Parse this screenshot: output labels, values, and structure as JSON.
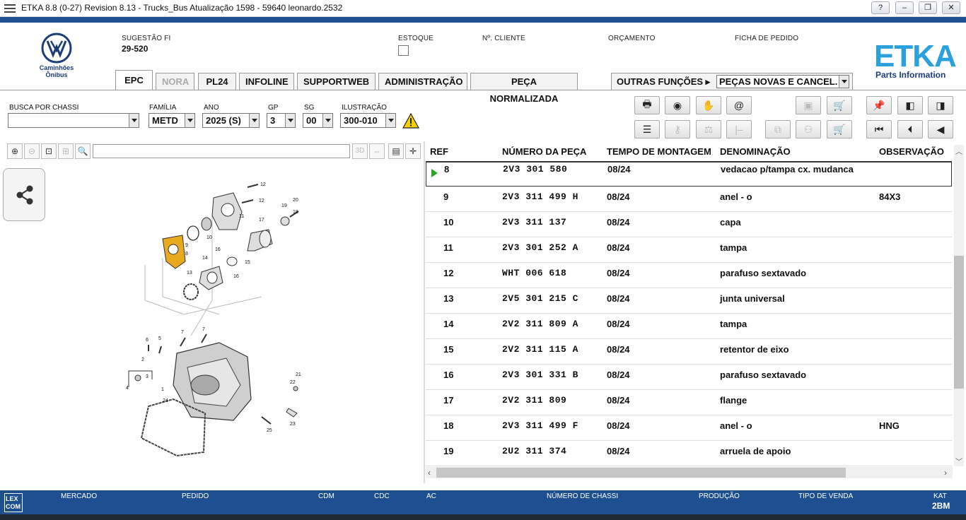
{
  "window": {
    "title": "ETKA 8.8 (0-27) Revision 8.13 - Trucks_Bus Atualização 1598 - 59640 leonardo.2532",
    "buttons": [
      "?",
      "–",
      "❐",
      "✕"
    ]
  },
  "header": {
    "brand_sub_1": "Caminhões",
    "brand_sub_2": "Ônibus",
    "sugestao_label": "SUGESTÃO FI",
    "sugestao_value": "29-520",
    "estoque_label": "ESTOQUE",
    "cliente_label": "Nº. CLIENTE",
    "orcamento_label": "ORÇAMENTO",
    "ficha_label": "FICHA DE PEDIDO",
    "etka_logo": "ETKA",
    "etka_sub": "Parts Information"
  },
  "tabs": [
    {
      "label": "EPC",
      "active": true
    },
    {
      "label": "NORA",
      "disabled": true
    },
    {
      "label": "PL24"
    },
    {
      "label": "INFOLINE"
    },
    {
      "label": "SUPPORTWEB"
    },
    {
      "label": "ADMINISTRAÇÃO"
    },
    {
      "label": "PEÇA NORMALIZADA"
    }
  ],
  "outras": {
    "label": "OUTRAS FUNÇÕES ▸",
    "selected": "PEÇAS NOVAS E CANCEL."
  },
  "filters": {
    "chassi_label": "BUSCA POR CHASSI",
    "chassi_value": "",
    "familia_label": "FAMÍLIA",
    "familia_value": "METD",
    "ano_label": "ANO",
    "ano_value": "2025 (S)",
    "gp_label": "GP",
    "gp_value": "3",
    "sg_label": "SG",
    "sg_value": "00",
    "ilustracao_label": "ILUSTRAÇÃO",
    "ilustracao_value": "300-010"
  },
  "table": {
    "headers": [
      "REF",
      "NÚMERO DA PEÇA",
      "TEMPO DE MONTAGEM",
      "DENOMINAÇÃO",
      "OBSERVAÇÃO"
    ],
    "rows": [
      {
        "ref": "8",
        "part": "2V3 301 580",
        "tempo": "08/24",
        "denom": "vedacao p/tampa cx. mudanca",
        "obs": ""
      },
      {
        "ref": "9",
        "part": "2V3 311 499 H",
        "tempo": "08/24",
        "denom": "anel - o",
        "obs": "84X3"
      },
      {
        "ref": "10",
        "part": "2V3 311 137",
        "tempo": "08/24",
        "denom": "capa",
        "obs": ""
      },
      {
        "ref": "11",
        "part": "2V3 301 252 A",
        "tempo": "08/24",
        "denom": "tampa",
        "obs": ""
      },
      {
        "ref": "12",
        "part": "WHT 006 618",
        "tempo": "08/24",
        "denom": "parafuso sextavado",
        "obs": ""
      },
      {
        "ref": "13",
        "part": "2V5 301 215 C",
        "tempo": "08/24",
        "denom": "junta universal",
        "obs": ""
      },
      {
        "ref": "14",
        "part": "2V2 311 809 A",
        "tempo": "08/24",
        "denom": "tampa",
        "obs": ""
      },
      {
        "ref": "15",
        "part": "2V2 311 115 A",
        "tempo": "08/24",
        "denom": "retentor de eixo",
        "obs": ""
      },
      {
        "ref": "16",
        "part": "2V3 301 331 B",
        "tempo": "08/24",
        "denom": "parafuso sextavado",
        "obs": ""
      },
      {
        "ref": "17",
        "part": "2V2 311 809",
        "tempo": "08/24",
        "denom": "flange",
        "obs": ""
      },
      {
        "ref": "18",
        "part": "2V3 311 499 F",
        "tempo": "08/24",
        "denom": "anel - o",
        "obs": "HNG"
      },
      {
        "ref": "19",
        "part": "2U2 311 374",
        "tempo": "08/24",
        "denom": "arruela de apoio",
        "obs": ""
      }
    ]
  },
  "diagram": {
    "labels": [
      "12",
      "12",
      "11",
      "20",
      "19",
      "18",
      "17",
      "10",
      "9",
      "8",
      "16",
      "15",
      "14",
      "16",
      "13",
      "7",
      "7",
      "6",
      "5",
      "2",
      "3",
      "4",
      "1",
      "21",
      "22",
      "23",
      "25",
      "24"
    ]
  },
  "footer": {
    "lexcom": "LEX COM",
    "mercado": "MERCADO",
    "pedido": "PEDIDO",
    "cdm": "CDM",
    "cdc": "CDC",
    "ac": "AC",
    "chassi": "NÚMERO DE CHASSI",
    "producao": "PRODUÇÃO",
    "tipo_venda": "TIPO DE VENDA",
    "kat_label": "KAT",
    "kat_value": "2BM"
  }
}
